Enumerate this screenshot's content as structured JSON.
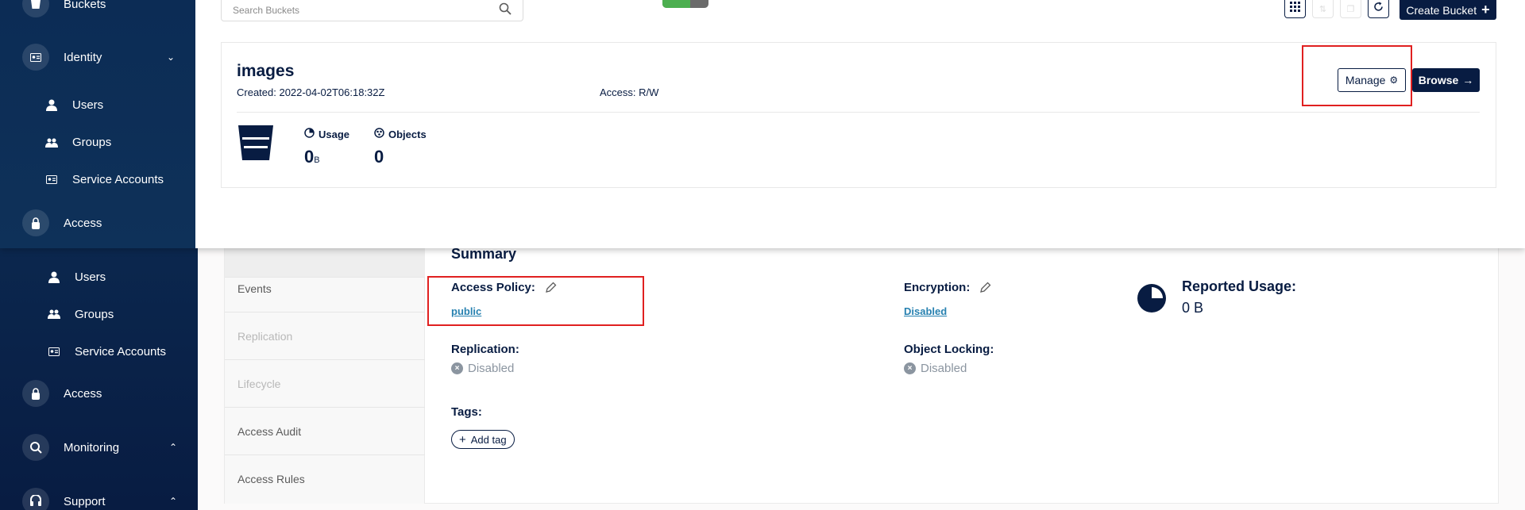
{
  "sidebar": {
    "top_items": [
      {
        "label": "Buckets"
      },
      {
        "label": "Identity"
      },
      {
        "label": "Users"
      },
      {
        "label": "Groups"
      },
      {
        "label": "Service Accounts"
      },
      {
        "label": "Access"
      }
    ],
    "bottom_items": [
      {
        "label": "Users"
      },
      {
        "label": "Groups"
      },
      {
        "label": "Service Accounts"
      },
      {
        "label": "Access"
      },
      {
        "label": "Monitoring"
      },
      {
        "label": "Support"
      }
    ]
  },
  "toolbar": {
    "search_placeholder": "Search Buckets",
    "progress_fraction": 0.6,
    "create_label": "Create Bucket"
  },
  "bucket": {
    "name": "images",
    "created": "Created: 2022-04-02T06:18:32Z",
    "access": "Access: R/W",
    "manage_label": "Manage",
    "browse_label": "Browse",
    "usage_label": "Usage",
    "usage_value": "0",
    "usage_unit": "B",
    "objects_label": "Objects",
    "objects_value": "0"
  },
  "tabs": [
    {
      "label": ""
    },
    {
      "label": "Events"
    },
    {
      "label": "Replication"
    },
    {
      "label": "Lifecycle"
    },
    {
      "label": "Access Audit"
    },
    {
      "label": "Access Rules"
    }
  ],
  "summary": {
    "title": "Summary",
    "access_policy_label": "Access Policy:",
    "access_policy_value": "public",
    "encryption_label": "Encryption:",
    "encryption_value": "Disabled",
    "replication_label": "Replication:",
    "replication_value": "Disabled",
    "object_locking_label": "Object Locking:",
    "object_locking_value": "Disabled",
    "tags_label": "Tags:",
    "add_tag_label": "Add tag",
    "reported_usage_label": "Reported Usage:",
    "reported_usage_value": "0 B"
  },
  "colors": {
    "navy": "#081c42",
    "highlight": "#e02020",
    "link": "#2781b0"
  }
}
